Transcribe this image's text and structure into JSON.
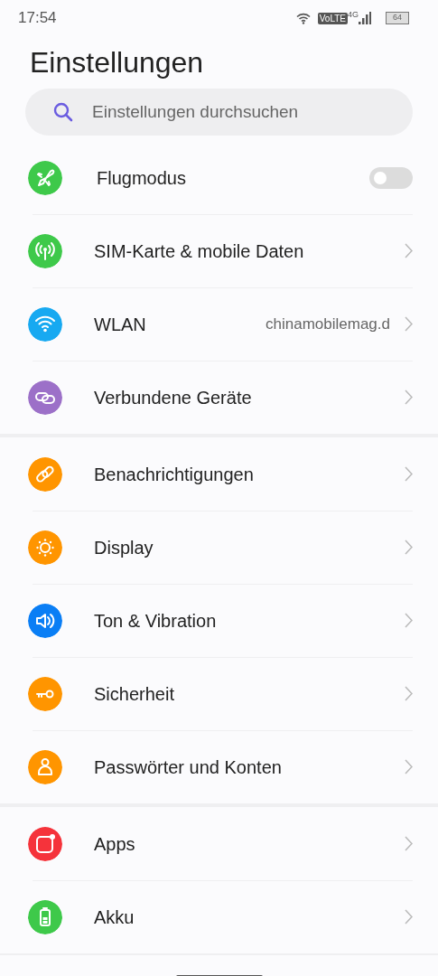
{
  "status_bar": {
    "time": "17:54",
    "volte": "VoLTE",
    "network": "4G",
    "battery": "64"
  },
  "title": "Einstellungen",
  "search": {
    "placeholder": "Einstellungen durchsuchen"
  },
  "groups": [
    [
      {
        "label": "Flugmodus",
        "kind": "toggle",
        "on": false,
        "color": "#3ec94a"
      },
      {
        "label": "SIM-Karte & mobile Daten",
        "kind": "link",
        "color": "#3ec94a"
      },
      {
        "label": "WLAN",
        "kind": "link",
        "value": "chinamobilemag.d",
        "color": "#17a9f1"
      },
      {
        "label": "Verbundene Geräte",
        "kind": "link",
        "color": "#9c70c8"
      }
    ],
    [
      {
        "label": "Benachrichtigungen",
        "kind": "link",
        "color": "#ff9500"
      },
      {
        "label": "Display",
        "kind": "link",
        "color": "#ff9500"
      },
      {
        "label": "Ton & Vibration",
        "kind": "link",
        "color": "#0a7ef5"
      },
      {
        "label": "Sicherheit",
        "kind": "link",
        "color": "#ff9500"
      },
      {
        "label": "Passwörter und Konten",
        "kind": "link",
        "color": "#ff9500"
      }
    ],
    [
      {
        "label": "Apps",
        "kind": "link",
        "color": "#f5333b"
      },
      {
        "label": "Akku",
        "kind": "link",
        "color": "#3ec94a"
      }
    ]
  ]
}
